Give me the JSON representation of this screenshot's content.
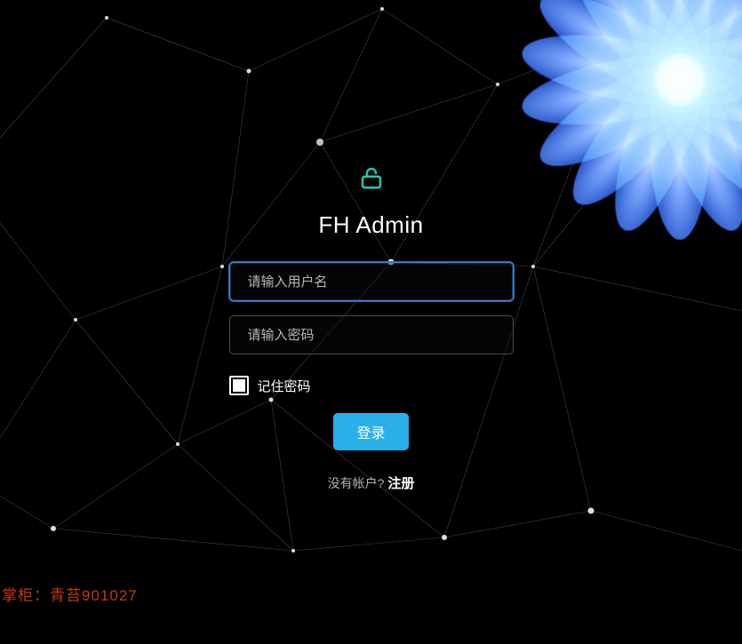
{
  "header": {
    "title": "FH Admin"
  },
  "form": {
    "username_placeholder": "请输入用户名",
    "username_value": "",
    "password_placeholder": "请输入密码",
    "password_value": "",
    "remember_label": "记住密码",
    "remember_checked": false,
    "login_button": "登录"
  },
  "signup": {
    "prompt": "没有帐户?",
    "link": "注册"
  },
  "footer": {
    "text": "掌柜：青苔901027"
  },
  "colors": {
    "accent": "#29b0e8",
    "lock_icon": "#1ec9b5",
    "focus_border": "#3a86d1",
    "footer_text": "#c13717"
  }
}
